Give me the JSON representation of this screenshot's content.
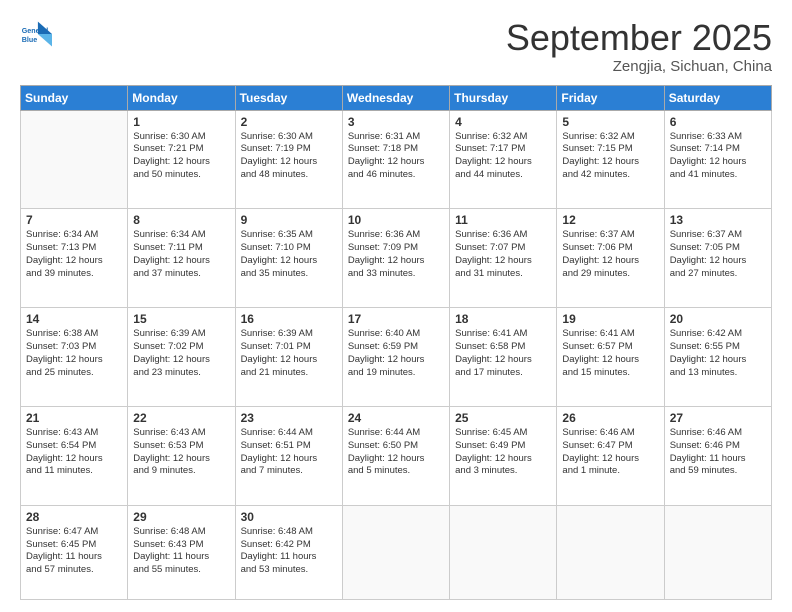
{
  "logo": {
    "line1": "General",
    "line2": "Blue"
  },
  "title": "September 2025",
  "subtitle": "Zengjia, Sichuan, China",
  "days_header": [
    "Sunday",
    "Monday",
    "Tuesday",
    "Wednesday",
    "Thursday",
    "Friday",
    "Saturday"
  ],
  "weeks": [
    [
      {
        "day": "",
        "text": ""
      },
      {
        "day": "1",
        "text": "Sunrise: 6:30 AM\nSunset: 7:21 PM\nDaylight: 12 hours\nand 50 minutes."
      },
      {
        "day": "2",
        "text": "Sunrise: 6:30 AM\nSunset: 7:19 PM\nDaylight: 12 hours\nand 48 minutes."
      },
      {
        "day": "3",
        "text": "Sunrise: 6:31 AM\nSunset: 7:18 PM\nDaylight: 12 hours\nand 46 minutes."
      },
      {
        "day": "4",
        "text": "Sunrise: 6:32 AM\nSunset: 7:17 PM\nDaylight: 12 hours\nand 44 minutes."
      },
      {
        "day": "5",
        "text": "Sunrise: 6:32 AM\nSunset: 7:15 PM\nDaylight: 12 hours\nand 42 minutes."
      },
      {
        "day": "6",
        "text": "Sunrise: 6:33 AM\nSunset: 7:14 PM\nDaylight: 12 hours\nand 41 minutes."
      }
    ],
    [
      {
        "day": "7",
        "text": "Sunrise: 6:34 AM\nSunset: 7:13 PM\nDaylight: 12 hours\nand 39 minutes."
      },
      {
        "day": "8",
        "text": "Sunrise: 6:34 AM\nSunset: 7:11 PM\nDaylight: 12 hours\nand 37 minutes."
      },
      {
        "day": "9",
        "text": "Sunrise: 6:35 AM\nSunset: 7:10 PM\nDaylight: 12 hours\nand 35 minutes."
      },
      {
        "day": "10",
        "text": "Sunrise: 6:36 AM\nSunset: 7:09 PM\nDaylight: 12 hours\nand 33 minutes."
      },
      {
        "day": "11",
        "text": "Sunrise: 6:36 AM\nSunset: 7:07 PM\nDaylight: 12 hours\nand 31 minutes."
      },
      {
        "day": "12",
        "text": "Sunrise: 6:37 AM\nSunset: 7:06 PM\nDaylight: 12 hours\nand 29 minutes."
      },
      {
        "day": "13",
        "text": "Sunrise: 6:37 AM\nSunset: 7:05 PM\nDaylight: 12 hours\nand 27 minutes."
      }
    ],
    [
      {
        "day": "14",
        "text": "Sunrise: 6:38 AM\nSunset: 7:03 PM\nDaylight: 12 hours\nand 25 minutes."
      },
      {
        "day": "15",
        "text": "Sunrise: 6:39 AM\nSunset: 7:02 PM\nDaylight: 12 hours\nand 23 minutes."
      },
      {
        "day": "16",
        "text": "Sunrise: 6:39 AM\nSunset: 7:01 PM\nDaylight: 12 hours\nand 21 minutes."
      },
      {
        "day": "17",
        "text": "Sunrise: 6:40 AM\nSunset: 6:59 PM\nDaylight: 12 hours\nand 19 minutes."
      },
      {
        "day": "18",
        "text": "Sunrise: 6:41 AM\nSunset: 6:58 PM\nDaylight: 12 hours\nand 17 minutes."
      },
      {
        "day": "19",
        "text": "Sunrise: 6:41 AM\nSunset: 6:57 PM\nDaylight: 12 hours\nand 15 minutes."
      },
      {
        "day": "20",
        "text": "Sunrise: 6:42 AM\nSunset: 6:55 PM\nDaylight: 12 hours\nand 13 minutes."
      }
    ],
    [
      {
        "day": "21",
        "text": "Sunrise: 6:43 AM\nSunset: 6:54 PM\nDaylight: 12 hours\nand 11 minutes."
      },
      {
        "day": "22",
        "text": "Sunrise: 6:43 AM\nSunset: 6:53 PM\nDaylight: 12 hours\nand 9 minutes."
      },
      {
        "day": "23",
        "text": "Sunrise: 6:44 AM\nSunset: 6:51 PM\nDaylight: 12 hours\nand 7 minutes."
      },
      {
        "day": "24",
        "text": "Sunrise: 6:44 AM\nSunset: 6:50 PM\nDaylight: 12 hours\nand 5 minutes."
      },
      {
        "day": "25",
        "text": "Sunrise: 6:45 AM\nSunset: 6:49 PM\nDaylight: 12 hours\nand 3 minutes."
      },
      {
        "day": "26",
        "text": "Sunrise: 6:46 AM\nSunset: 6:47 PM\nDaylight: 12 hours\nand 1 minute."
      },
      {
        "day": "27",
        "text": "Sunrise: 6:46 AM\nSunset: 6:46 PM\nDaylight: 11 hours\nand 59 minutes."
      }
    ],
    [
      {
        "day": "28",
        "text": "Sunrise: 6:47 AM\nSunset: 6:45 PM\nDaylight: 11 hours\nand 57 minutes."
      },
      {
        "day": "29",
        "text": "Sunrise: 6:48 AM\nSunset: 6:43 PM\nDaylight: 11 hours\nand 55 minutes."
      },
      {
        "day": "30",
        "text": "Sunrise: 6:48 AM\nSunset: 6:42 PM\nDaylight: 11 hours\nand 53 minutes."
      },
      {
        "day": "",
        "text": ""
      },
      {
        "day": "",
        "text": ""
      },
      {
        "day": "",
        "text": ""
      },
      {
        "day": "",
        "text": ""
      }
    ]
  ]
}
